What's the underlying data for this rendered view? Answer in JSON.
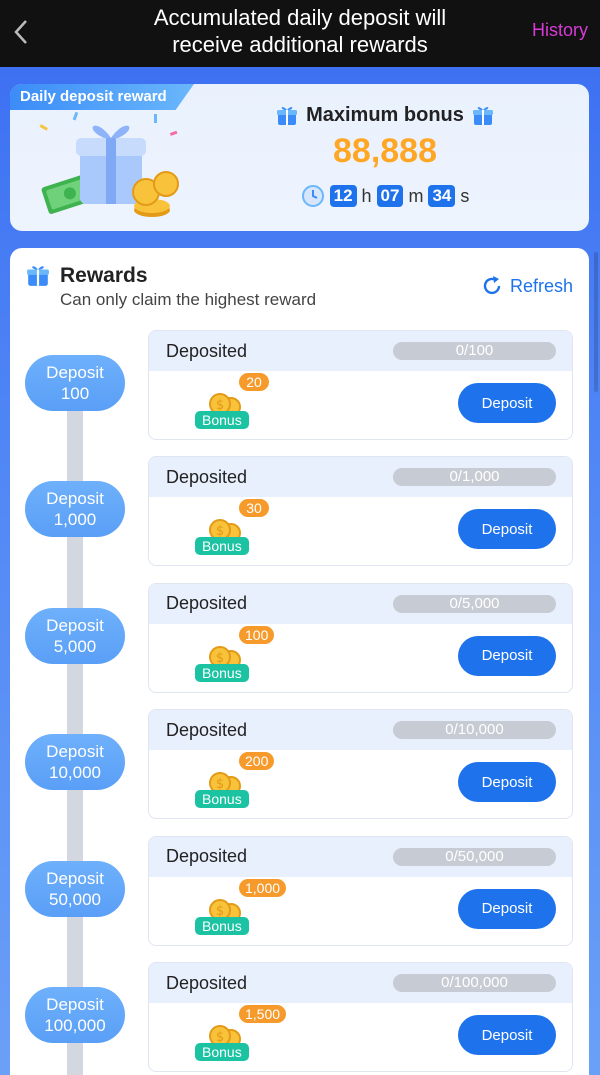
{
  "header": {
    "title_line1": "Accumulated daily deposit will",
    "title_line2": "receive additional rewards",
    "history_label": "History"
  },
  "top_card": {
    "badge": "Daily deposit reward",
    "max_bonus_label": "Maximum bonus",
    "max_bonus_value": "88,888",
    "timer": {
      "hours": "12",
      "h": "h",
      "minutes": "07",
      "m": "m",
      "seconds": "34",
      "s": "s"
    }
  },
  "rewards": {
    "title": "Rewards",
    "subtitle": "Can only claim the highest reward",
    "refresh_label": "Refresh",
    "tiers": [
      {
        "deposit_label": "Deposit",
        "deposit_amount": "100",
        "deposited_label": "Deposited",
        "progress": "0/100",
        "progress_fraction": 0,
        "bonus": "20",
        "bonus_tag": "Bonus",
        "button": "Deposit"
      },
      {
        "deposit_label": "Deposit",
        "deposit_amount": "1,000",
        "deposited_label": "Deposited",
        "progress": "0/1,000",
        "progress_fraction": 0,
        "bonus": "30",
        "bonus_tag": "Bonus",
        "button": "Deposit"
      },
      {
        "deposit_label": "Deposit",
        "deposit_amount": "5,000",
        "deposited_label": "Deposited",
        "progress": "0/5,000",
        "progress_fraction": 0,
        "bonus": "100",
        "bonus_tag": "Bonus",
        "button": "Deposit"
      },
      {
        "deposit_label": "Deposit",
        "deposit_amount": "10,000",
        "deposited_label": "Deposited",
        "progress": "0/10,000",
        "progress_fraction": 0,
        "bonus": "200",
        "bonus_tag": "Bonus",
        "button": "Deposit"
      },
      {
        "deposit_label": "Deposit",
        "deposit_amount": "50,000",
        "deposited_label": "Deposited",
        "progress": "0/50,000",
        "progress_fraction": 0,
        "bonus": "1,000",
        "bonus_tag": "Bonus",
        "button": "Deposit"
      },
      {
        "deposit_label": "Deposit",
        "deposit_amount": "100,000",
        "deposited_label": "Deposited",
        "progress": "0/100,000",
        "progress_fraction": 0,
        "bonus": "1,500",
        "bonus_tag": "Bonus",
        "button": "Deposit"
      }
    ]
  },
  "colors": {
    "accent": "#1e73ec",
    "bonus_value": "#ffa724",
    "history": "#d63bd6",
    "bonus_tag": "#1cc3a3",
    "bonus_amount": "#f59a2b"
  }
}
